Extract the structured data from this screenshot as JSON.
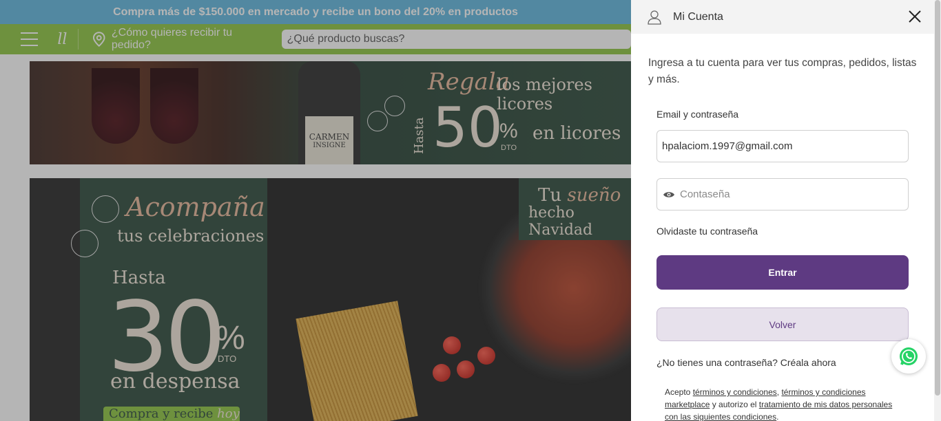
{
  "promo": {
    "text": "Compra más de $150.000 en mercado y recibe un bono del 20% en productos"
  },
  "nav": {
    "delivery_text": "¿Cómo quieres recibir tu pedido?",
    "search_placeholder": "¿Qué producto buscas?"
  },
  "banner1": {
    "script": "Regala",
    "title": "los mejores licores",
    "hasta": "Hasta",
    "number": "50",
    "pct": "%",
    "dto": "DTO",
    "sub": "en licores",
    "bottle_label": [
      "CARMEN",
      "INSIGNE"
    ]
  },
  "banner2": {
    "script": "Acompaña",
    "title": "tus celebraciones",
    "hasta": "Hasta",
    "number": "30",
    "pct": "%",
    "dto": "DTO",
    "sub": "en despensa",
    "pill": "Compra y recibe",
    "pill_hoy": "hoy",
    "tag_line1_a": "Tu",
    "tag_line1_b": "sueño",
    "tag_line2": "hecho Navidad"
  },
  "drawer": {
    "title": "Mi Cuenta",
    "intro": "Ingresa a tu cuenta para ver tus compras, pedidos, listas y más.",
    "field_label": "Email y contraseña",
    "email_value": "hpalaciom.1997@gmail.com",
    "password_placeholder": "Contaseña",
    "forgot": "Olvidaste tu contraseña",
    "enter_label": "Entrar",
    "back_label": "Volver",
    "signup": "¿No tienes una contraseña? Créala ahora",
    "terms": {
      "prefix": "Acepto",
      "link1": "términos y condiciones",
      "sep1": ",",
      "link2": "términos y condiciones marketplace",
      "mid": "y autorizo el",
      "link3": "tratamiento de mis datos personales con las siguientes condiciones",
      "suffix": "."
    }
  },
  "colors": {
    "promo_bg": "#5fb6df",
    "nav_bg": "#8dc63f",
    "accent_purple": "#5e3a82",
    "back_bg": "#e7e1ec",
    "whatsapp": "#25d366"
  },
  "icons": [
    "menu-icon",
    "logo-icon",
    "location-pin-icon",
    "user-icon",
    "close-icon",
    "eye-icon",
    "whatsapp-icon"
  ]
}
